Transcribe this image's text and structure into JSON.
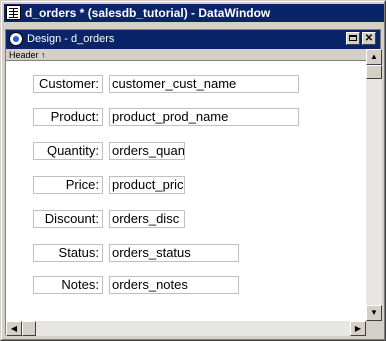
{
  "window": {
    "title": "d_orders * (salesdb_tutorial) - DataWindow"
  },
  "design_pane": {
    "title": "Design - d_orders",
    "header_band_label": "Header ↑"
  },
  "rows": [
    {
      "label": "Customer:",
      "field": "customer_cust_name"
    },
    {
      "label": "Product:",
      "field": "product_prod_name"
    },
    {
      "label": "Quantity:",
      "field": "orders_quan"
    },
    {
      "label": "Price:",
      "field": "product_pric"
    },
    {
      "label": "Discount:",
      "field": "orders_disc"
    },
    {
      "label": "Status:",
      "field": "orders_status"
    },
    {
      "label": "Notes:",
      "field": "orders_notes"
    }
  ],
  "icons": {
    "window_icon": "datawindow-grid-icon",
    "design_icon": "design-globe-icon",
    "maximize": "maximize-icon",
    "close": "close-icon",
    "scroll_up": "arrow-up-icon",
    "scroll_down": "arrow-down-icon",
    "scroll_left": "arrow-left-icon",
    "scroll_right": "arrow-right-icon"
  },
  "glyphs": {
    "close": "✕",
    "up": "▲",
    "down": "▼",
    "left": "◀",
    "right": "▶"
  }
}
